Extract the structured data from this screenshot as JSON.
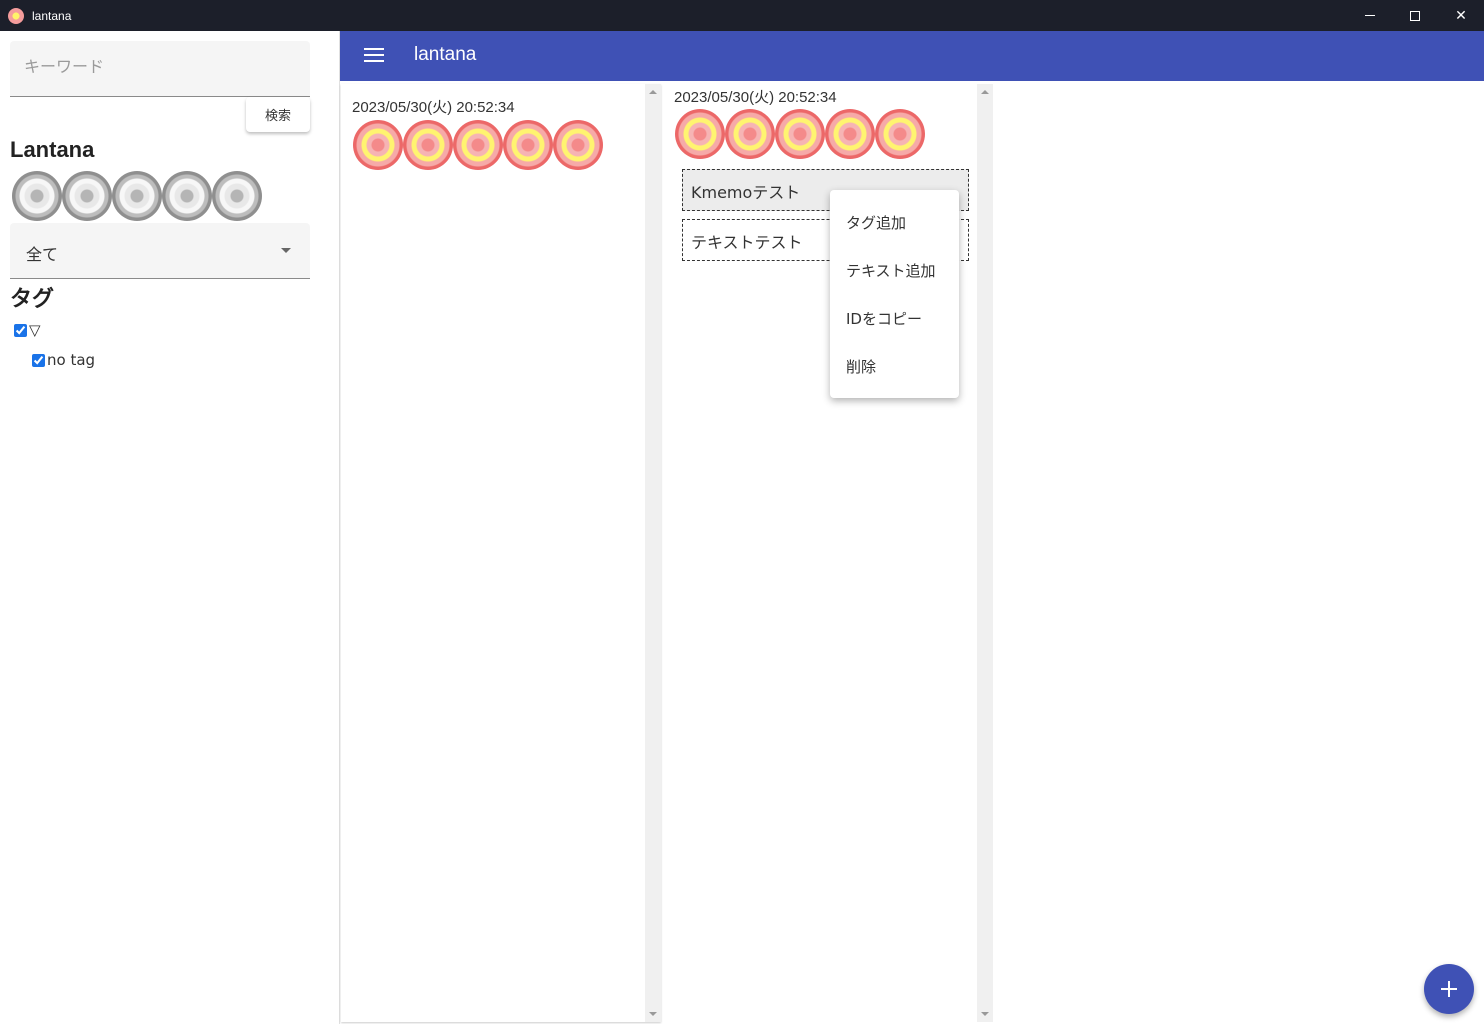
{
  "window": {
    "title": "lantana",
    "controls": [
      "minimize-icon",
      "maximize-icon",
      "close-icon"
    ]
  },
  "sidebar": {
    "search_placeholder": "キーワード",
    "search_value": "",
    "search_button": "検索",
    "brand_title": "Lantana",
    "rating_flowers": 5,
    "filter_selected": "全て",
    "tag_heading": "タグ",
    "tags": [
      {
        "label": "▽",
        "checked": true
      },
      {
        "label": "no tag",
        "checked": true
      }
    ]
  },
  "appbar": {
    "title": "lantana",
    "menu_icon": "hamburger-menu-icon",
    "color": "#3f51b5"
  },
  "columns": [
    {
      "timestamp": "2023/05/30(火) 20:52:34",
      "flowers": 5,
      "memos": []
    },
    {
      "timestamp": "2023/05/30(火) 20:52:34",
      "flowers": 5,
      "memos": [
        "Kmemoテスト",
        "テキストテスト"
      ]
    }
  ],
  "context_menu": {
    "items": [
      "タグ追加",
      "テキスト追加",
      "IDをコピー",
      "削除"
    ]
  },
  "fab": {
    "icon": "plus-icon",
    "color": "#3f51b5"
  }
}
